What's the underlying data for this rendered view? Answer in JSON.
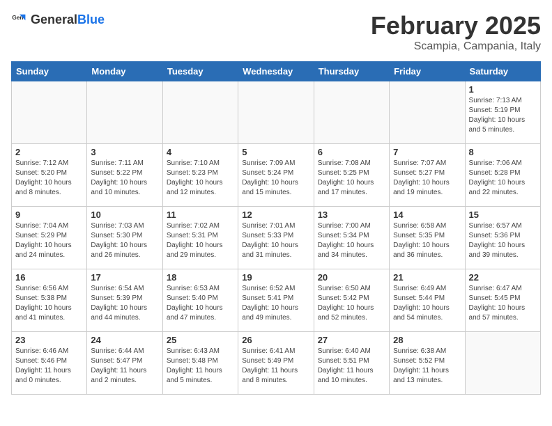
{
  "header": {
    "logo_general": "General",
    "logo_blue": "Blue",
    "month_title": "February 2025",
    "location": "Scampia, Campania, Italy"
  },
  "days_of_week": [
    "Sunday",
    "Monday",
    "Tuesday",
    "Wednesday",
    "Thursday",
    "Friday",
    "Saturday"
  ],
  "weeks": [
    [
      {
        "day": "",
        "info": ""
      },
      {
        "day": "",
        "info": ""
      },
      {
        "day": "",
        "info": ""
      },
      {
        "day": "",
        "info": ""
      },
      {
        "day": "",
        "info": ""
      },
      {
        "day": "",
        "info": ""
      },
      {
        "day": "1",
        "info": "Sunrise: 7:13 AM\nSunset: 5:19 PM\nDaylight: 10 hours\nand 5 minutes."
      }
    ],
    [
      {
        "day": "2",
        "info": "Sunrise: 7:12 AM\nSunset: 5:20 PM\nDaylight: 10 hours\nand 8 minutes."
      },
      {
        "day": "3",
        "info": "Sunrise: 7:11 AM\nSunset: 5:22 PM\nDaylight: 10 hours\nand 10 minutes."
      },
      {
        "day": "4",
        "info": "Sunrise: 7:10 AM\nSunset: 5:23 PM\nDaylight: 10 hours\nand 12 minutes."
      },
      {
        "day": "5",
        "info": "Sunrise: 7:09 AM\nSunset: 5:24 PM\nDaylight: 10 hours\nand 15 minutes."
      },
      {
        "day": "6",
        "info": "Sunrise: 7:08 AM\nSunset: 5:25 PM\nDaylight: 10 hours\nand 17 minutes."
      },
      {
        "day": "7",
        "info": "Sunrise: 7:07 AM\nSunset: 5:27 PM\nDaylight: 10 hours\nand 19 minutes."
      },
      {
        "day": "8",
        "info": "Sunrise: 7:06 AM\nSunset: 5:28 PM\nDaylight: 10 hours\nand 22 minutes."
      }
    ],
    [
      {
        "day": "9",
        "info": "Sunrise: 7:04 AM\nSunset: 5:29 PM\nDaylight: 10 hours\nand 24 minutes."
      },
      {
        "day": "10",
        "info": "Sunrise: 7:03 AM\nSunset: 5:30 PM\nDaylight: 10 hours\nand 26 minutes."
      },
      {
        "day": "11",
        "info": "Sunrise: 7:02 AM\nSunset: 5:31 PM\nDaylight: 10 hours\nand 29 minutes."
      },
      {
        "day": "12",
        "info": "Sunrise: 7:01 AM\nSunset: 5:33 PM\nDaylight: 10 hours\nand 31 minutes."
      },
      {
        "day": "13",
        "info": "Sunrise: 7:00 AM\nSunset: 5:34 PM\nDaylight: 10 hours\nand 34 minutes."
      },
      {
        "day": "14",
        "info": "Sunrise: 6:58 AM\nSunset: 5:35 PM\nDaylight: 10 hours\nand 36 minutes."
      },
      {
        "day": "15",
        "info": "Sunrise: 6:57 AM\nSunset: 5:36 PM\nDaylight: 10 hours\nand 39 minutes."
      }
    ],
    [
      {
        "day": "16",
        "info": "Sunrise: 6:56 AM\nSunset: 5:38 PM\nDaylight: 10 hours\nand 41 minutes."
      },
      {
        "day": "17",
        "info": "Sunrise: 6:54 AM\nSunset: 5:39 PM\nDaylight: 10 hours\nand 44 minutes."
      },
      {
        "day": "18",
        "info": "Sunrise: 6:53 AM\nSunset: 5:40 PM\nDaylight: 10 hours\nand 47 minutes."
      },
      {
        "day": "19",
        "info": "Sunrise: 6:52 AM\nSunset: 5:41 PM\nDaylight: 10 hours\nand 49 minutes."
      },
      {
        "day": "20",
        "info": "Sunrise: 6:50 AM\nSunset: 5:42 PM\nDaylight: 10 hours\nand 52 minutes."
      },
      {
        "day": "21",
        "info": "Sunrise: 6:49 AM\nSunset: 5:44 PM\nDaylight: 10 hours\nand 54 minutes."
      },
      {
        "day": "22",
        "info": "Sunrise: 6:47 AM\nSunset: 5:45 PM\nDaylight: 10 hours\nand 57 minutes."
      }
    ],
    [
      {
        "day": "23",
        "info": "Sunrise: 6:46 AM\nSunset: 5:46 PM\nDaylight: 11 hours\nand 0 minutes."
      },
      {
        "day": "24",
        "info": "Sunrise: 6:44 AM\nSunset: 5:47 PM\nDaylight: 11 hours\nand 2 minutes."
      },
      {
        "day": "25",
        "info": "Sunrise: 6:43 AM\nSunset: 5:48 PM\nDaylight: 11 hours\nand 5 minutes."
      },
      {
        "day": "26",
        "info": "Sunrise: 6:41 AM\nSunset: 5:49 PM\nDaylight: 11 hours\nand 8 minutes."
      },
      {
        "day": "27",
        "info": "Sunrise: 6:40 AM\nSunset: 5:51 PM\nDaylight: 11 hours\nand 10 minutes."
      },
      {
        "day": "28",
        "info": "Sunrise: 6:38 AM\nSunset: 5:52 PM\nDaylight: 11 hours\nand 13 minutes."
      },
      {
        "day": "",
        "info": ""
      }
    ]
  ]
}
